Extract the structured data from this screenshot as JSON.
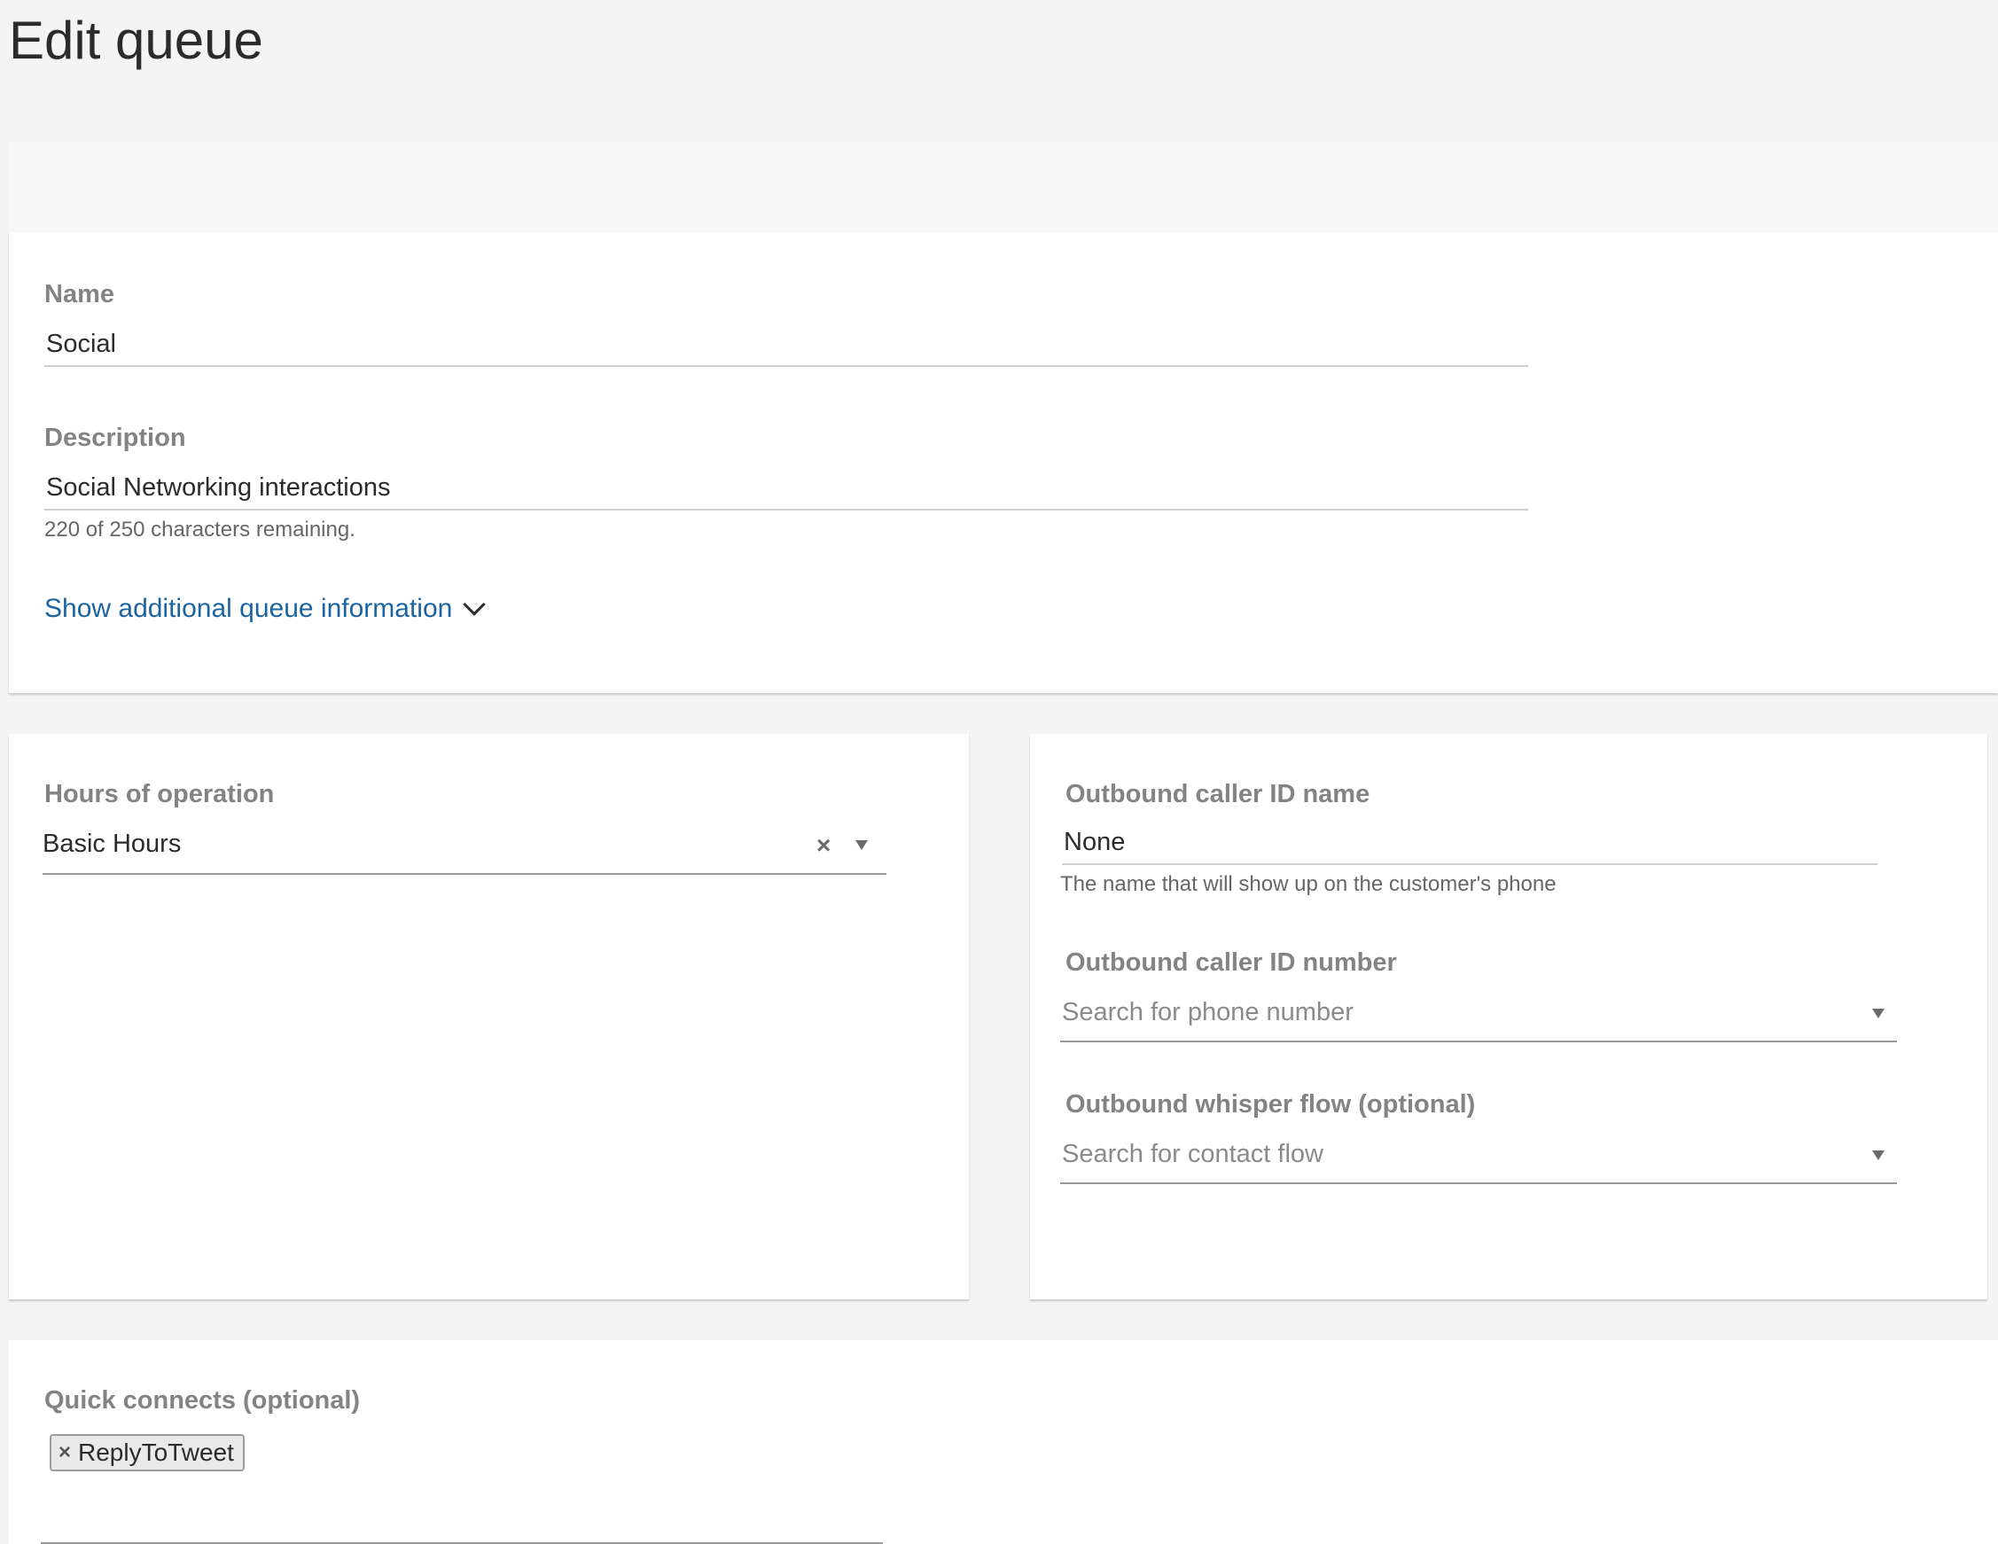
{
  "page": {
    "title": "Edit queue"
  },
  "queue": {
    "name_label": "Name",
    "name_value": "Social",
    "description_label": "Description",
    "description_value": "Social Networking interactions",
    "description_counter": "220 of 250 characters remaining.",
    "additional_info_link": "Show additional queue information"
  },
  "hours": {
    "label": "Hours of operation",
    "value": "Basic Hours",
    "clear_symbol": "×"
  },
  "outbound": {
    "caller_name_label": "Outbound caller ID name",
    "caller_name_value": "None",
    "caller_name_hint": "The name that will show up on the customer's phone",
    "caller_number_label": "Outbound caller ID number",
    "caller_number_placeholder": "Search for phone number",
    "whisper_label": "Outbound whisper flow (optional)",
    "whisper_placeholder": "Search for contact flow"
  },
  "quick_connects": {
    "label": "Quick connects (optional)",
    "chips": [
      {
        "label": "ReplyToTweet",
        "remove_symbol": "×"
      }
    ]
  },
  "icons": [
    "chevron-down-icon",
    "caret-down-icon",
    "clear-icon",
    "remove-chip-icon"
  ]
}
